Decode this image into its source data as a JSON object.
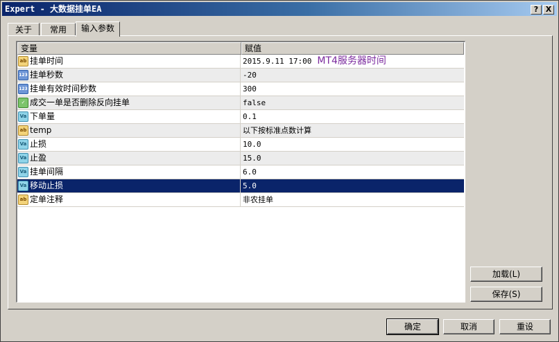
{
  "window": {
    "title": "Expert - 大数据挂单EA",
    "help_label": "?",
    "close_label": "X"
  },
  "tabs": [
    {
      "label": "关于"
    },
    {
      "label": "常用"
    },
    {
      "label": "输入参数"
    }
  ],
  "table": {
    "headers": [
      "变量",
      "赋值"
    ],
    "rows": [
      {
        "icon": "ab-string-icon",
        "icon_text": "ab",
        "name": "挂单时间",
        "value": "2015.9.11 17:00",
        "annotation": "MT4服务器时间"
      },
      {
        "icon": "int-123-icon",
        "icon_text": "123",
        "name": "挂单秒数",
        "value": "-20"
      },
      {
        "icon": "int-123-icon",
        "icon_text": "123",
        "name": "挂单有效时间秒数",
        "value": "300"
      },
      {
        "icon": "bool-icon",
        "icon_text": "✓",
        "name": "成交一单是否删除反向挂单",
        "value": "false"
      },
      {
        "icon": "double-val-icon",
        "icon_text": "Va",
        "name": "下单量",
        "value": "0.1"
      },
      {
        "icon": "ab-string-icon",
        "icon_text": "ab",
        "name": "temp",
        "value": "以下按标准点数计算"
      },
      {
        "icon": "double-val-icon",
        "icon_text": "Va",
        "name": "止损",
        "value": "10.0"
      },
      {
        "icon": "double-val-icon",
        "icon_text": "Va",
        "name": "止盈",
        "value": "15.0"
      },
      {
        "icon": "double-val-icon",
        "icon_text": "Va",
        "name": "挂单间隔",
        "value": "6.0"
      },
      {
        "icon": "double-val-icon",
        "icon_text": "Va",
        "name": "移动止损",
        "value": "5.0"
      },
      {
        "icon": "ab-string-icon",
        "icon_text": "ab",
        "name": "定单注释",
        "value": "非农挂单"
      }
    ],
    "selected_row": 9
  },
  "side_buttons": {
    "load": "加载(L)",
    "save": "保存(S)"
  },
  "bottom_buttons": {
    "ok": "确定",
    "cancel": "取消",
    "reset": "重设"
  },
  "colors": {
    "selection": "#0a246a",
    "annotation": "#7b2a9e"
  }
}
